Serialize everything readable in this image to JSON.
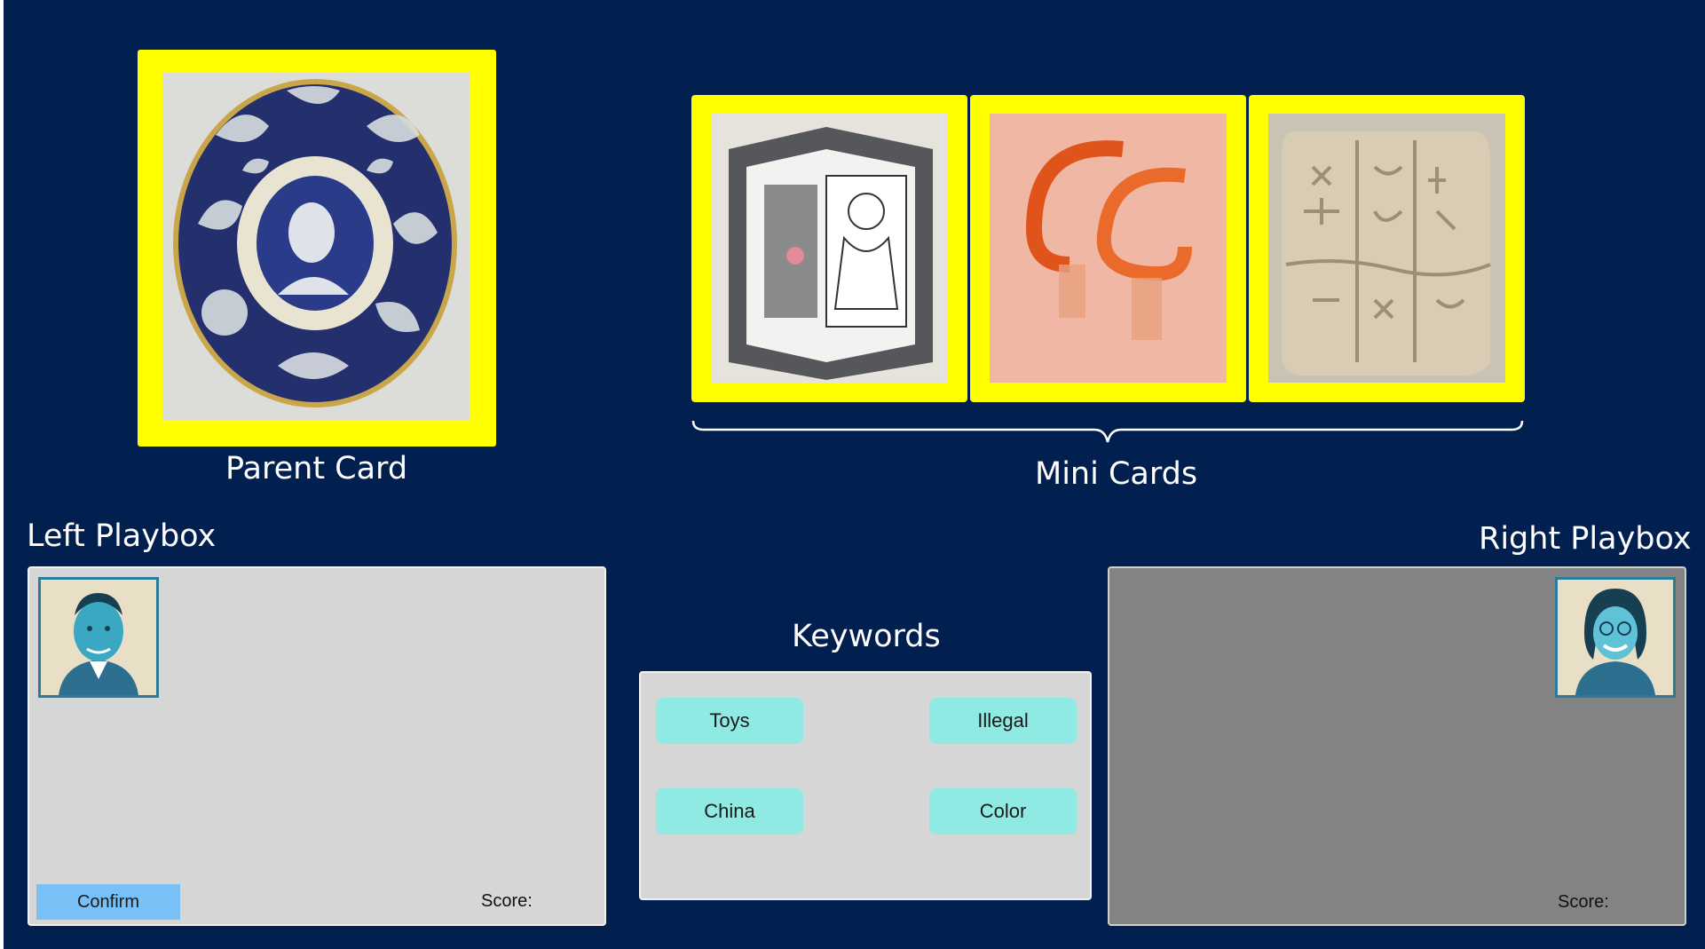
{
  "parent_card": {
    "caption": "Parent Card",
    "image": "maiolica-plate-with-portrait-medallion"
  },
  "mini_cards": {
    "caption": "Mini Cards",
    "items": [
      {
        "image": "pop-up-star-book"
      },
      {
        "image": "orange-glass-ribbon-sculpture"
      },
      {
        "image": "clay-cuneiform-tablet"
      }
    ]
  },
  "left_playbox": {
    "title": "Left Playbox",
    "avatar": "man-portrait-avatar",
    "confirm_label": "Confirm",
    "score_label": "Score:"
  },
  "right_playbox": {
    "title": "Right Playbox",
    "avatar": "woman-portrait-avatar",
    "score_label": "Score:"
  },
  "keywords": {
    "title": "Keywords",
    "items": [
      "Toys",
      "Illegal",
      "China",
      "Color"
    ]
  },
  "colors": {
    "background": "#012050",
    "card_frame": "#ffff00",
    "keyword_button": "#8eeae3",
    "confirm_button": "#79c0f7",
    "left_playbox": "#d6d6d6",
    "right_playbox": "#838383"
  }
}
